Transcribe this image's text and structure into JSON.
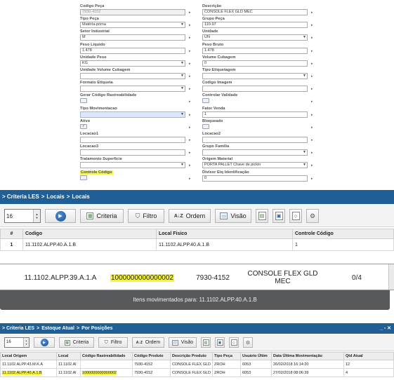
{
  "form": {
    "left": [
      {
        "label": "Codigo Peça",
        "value": "7930-4152",
        "kind": "readonly"
      },
      {
        "label": "Tipo Peça",
        "value": "Matéria-prima",
        "kind": "select"
      },
      {
        "label": "Setor Industrial",
        "value": "M",
        "kind": "text"
      },
      {
        "label": "Peso Liquido",
        "value": "1.478",
        "kind": "text"
      },
      {
        "label": "Unidade Peso",
        "value": "KG",
        "kind": "select"
      },
      {
        "label": "Unidade Volume Cubagem",
        "value": "",
        "kind": "select"
      },
      {
        "label": "Formato Etiqueta",
        "value": "",
        "kind": "select"
      },
      {
        "label": "Gerar Código Rastreabilidade",
        "value": "",
        "kind": "checkbox"
      },
      {
        "label": "Tipo Movimentacao",
        "value": "",
        "kind": "select-blue"
      },
      {
        "label": "Ativo",
        "value": "✓",
        "kind": "checkbox"
      },
      {
        "label": "Locacao1",
        "value": "",
        "kind": "text"
      },
      {
        "label": "Locacao3",
        "value": "",
        "kind": "text"
      },
      {
        "label": "Tratamento Superficie",
        "value": "",
        "kind": "select"
      },
      {
        "label": "Controle Código",
        "value": "",
        "kind": "checkbox-hl"
      }
    ],
    "right": [
      {
        "label": "Descrição",
        "value": "CONSOLE FLEX GLD MEC",
        "kind": "text"
      },
      {
        "label": "Grupo Peça",
        "value": "110-97",
        "kind": "text"
      },
      {
        "label": "Unidade",
        "value": "UN",
        "kind": "select"
      },
      {
        "label": "Peso Bruto",
        "value": "1.478",
        "kind": "text"
      },
      {
        "label": "Volume Cubagem",
        "value": "0",
        "kind": "text"
      },
      {
        "label": "Tipo Etiquetagem",
        "value": "",
        "kind": "select"
      },
      {
        "label": "Codigo Imagem",
        "value": "",
        "kind": "text"
      },
      {
        "label": "Controlar Validade",
        "value": "",
        "kind": "checkbox"
      },
      {
        "label": "Fator Venda",
        "value": "1",
        "kind": "text"
      },
      {
        "label": "Bloqueado",
        "value": "",
        "kind": "checkbox"
      },
      {
        "label": "Locacao2",
        "value": "",
        "kind": "text"
      },
      {
        "label": "Grupo Familia",
        "value": "",
        "kind": "select"
      },
      {
        "label": "Origem Material",
        "value": "PORTA PALLET Chave de pickin",
        "kind": "select"
      },
      {
        "label": "Divisor Etq Identificação",
        "value": "0",
        "kind": "text"
      }
    ]
  },
  "locais": {
    "breadcrumb": [
      "> Criteria LES",
      ">",
      "Locais",
      ">",
      "Locais"
    ],
    "toolbar": {
      "page_size": "16",
      "criteria_label": "Criteria",
      "filtro_label": "Filtro",
      "ordem_label": "Ordem",
      "visao_label": "Visão"
    },
    "columns": [
      "#",
      "Codigo",
      "Local Fisico",
      "Controle Código"
    ],
    "rows": [
      [
        "1",
        "11.1102.ALPP.40.A.1.B",
        "11.1102.ALPP.40.A.1.B",
        "1"
      ]
    ]
  },
  "movimento": {
    "local": "11.1102.ALPP.39.A.1.A",
    "rastreabilidade": "1000000000000002",
    "codigo": "7930-4152",
    "descricao": "CONSOLE FLEX GLD MEC",
    "quantidade": "0/4",
    "footer": "Itens movimentados para: 11.1102.ALPP.40.A.1.B"
  },
  "estoque": {
    "breadcrumb": [
      "> Criteria LES",
      ">",
      "Estoque Atual",
      ">",
      "Por Posições"
    ],
    "window_controls": "_ ▫ ✕",
    "toolbar": {
      "page_size": "16",
      "criteria_label": "Criteria",
      "filtro_label": "Filtro",
      "ordem_label": "Ordem",
      "visao_label": "Visão"
    },
    "columns": [
      "Local Origem",
      "Local",
      "Código Rastreabilidade",
      "Código Produto",
      "Descrição Produto",
      "Tipo Peça",
      "Usuário Últim",
      "Data Última Movimentação",
      "Qtd Atual"
    ],
    "rows": [
      [
        "11.1102.ALPP.43.M.K.A",
        "11.1102.Al",
        "",
        "7930-4152",
        "CONSOLE FLEX GLD I",
        "ZROH",
        "6053",
        "26/02/2018 16:14:20",
        "12"
      ],
      [
        "11.1102.ALPP.40.A.1.B",
        "11.1102.Al",
        "1000000000000002",
        "7930-4152",
        "CONSOLE FLEX GLD I",
        "ZROH",
        "6053",
        "27/02/2018 08:06:39",
        "4"
      ]
    ]
  },
  "colors": {
    "breadcrumb_bg": "#1f5f96",
    "highlight": "#f7f531",
    "footer_bg": "#58595b"
  }
}
